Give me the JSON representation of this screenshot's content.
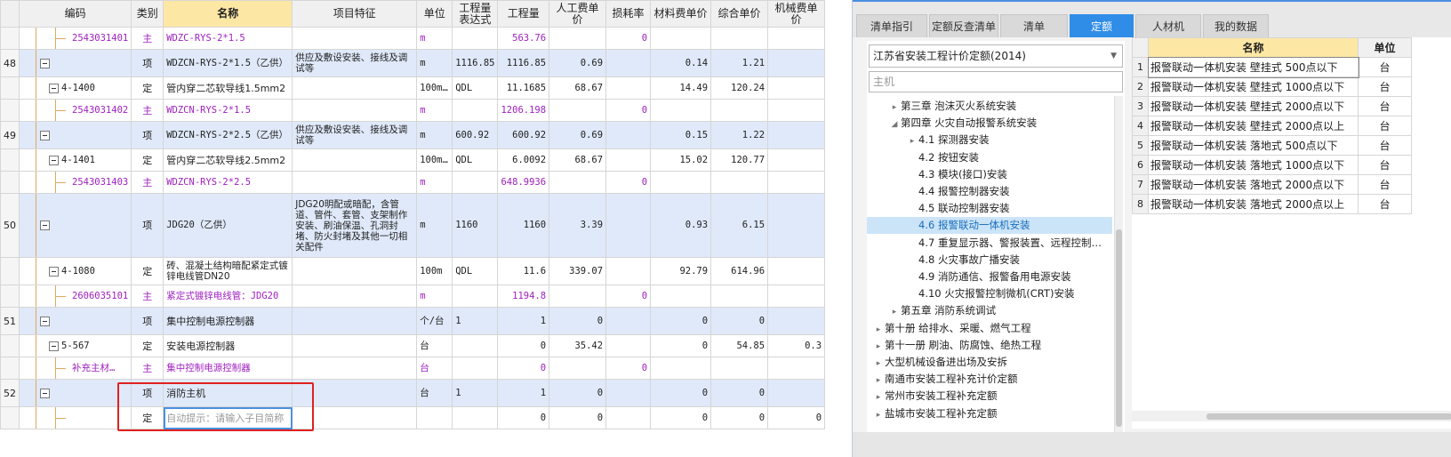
{
  "headers": [
    "",
    "编码",
    "类别",
    "名称",
    "项目特征",
    "单位",
    "工程量\n表达式",
    "工程量",
    "人工费单价",
    "损耗率",
    "材料费单价",
    "综合单价",
    "机械费单价"
  ],
  "rows": [
    {
      "type": "material",
      "num": "",
      "code": "2543031401",
      "cat": "主",
      "name": "WDZC-RYS-2*1.5",
      "feature": "",
      "unit": "m",
      "expr": "",
      "qty": "563.76",
      "labor": "",
      "loss": "0",
      "mat": "",
      "total": "",
      "mach": ""
    },
    {
      "type": "item",
      "num": "48",
      "code": "",
      "cat": "项",
      "name": "WDZCN-RYS-2*1.5（乙供）",
      "feature": "供应及敷设安装、接线及调试等",
      "unit": "m",
      "expr": "1116.85",
      "qty": "1116.85",
      "labor": "0.69",
      "loss": "",
      "mat": "0.14",
      "total": "1.21",
      "mach": ""
    },
    {
      "type": "quota",
      "num": "",
      "code": "4-1400",
      "cat": "定",
      "name": "管内穿二芯软导线1.5mm2",
      "feature": "",
      "unit": "100m…",
      "expr": "QDL",
      "qty": "11.1685",
      "labor": "68.67",
      "loss": "",
      "mat": "14.49",
      "total": "120.24",
      "mach": ""
    },
    {
      "type": "material",
      "num": "",
      "code": "2543031402",
      "cat": "主",
      "name": "WDZCN-RYS-2*1.5",
      "feature": "",
      "unit": "m",
      "expr": "",
      "qty": "1206.198",
      "labor": "",
      "loss": "0",
      "mat": "",
      "total": "",
      "mach": ""
    },
    {
      "type": "item",
      "num": "49",
      "code": "",
      "cat": "项",
      "name": "WDZCN-RYS-2*2.5（乙供）",
      "feature": "供应及敷设安装、接线及调试等",
      "unit": "m",
      "expr": "600.92",
      "qty": "600.92",
      "labor": "0.69",
      "loss": "",
      "mat": "0.15",
      "total": "1.22",
      "mach": ""
    },
    {
      "type": "quota",
      "num": "",
      "code": "4-1401",
      "cat": "定",
      "name": "管内穿二芯软导线2.5mm2",
      "feature": "",
      "unit": "100m…",
      "expr": "QDL",
      "qty": "6.0092",
      "labor": "68.67",
      "loss": "",
      "mat": "15.02",
      "total": "120.77",
      "mach": ""
    },
    {
      "type": "material",
      "num": "",
      "code": "2543031403",
      "cat": "主",
      "name": "WDZCN-RYS-2*2.5",
      "feature": "",
      "unit": "m",
      "expr": "",
      "qty": "648.9936",
      "labor": "",
      "loss": "0",
      "mat": "",
      "total": "",
      "mach": ""
    },
    {
      "type": "item",
      "num": "50",
      "code": "",
      "cat": "项",
      "name": "JDG20（乙供）",
      "feature": "JDG20明配或暗配，含管道、管件、套管、支架制作安装、刷油保温、孔洞封堵、防火封堵及其他一切相关配件",
      "unit": "m",
      "expr": "1160",
      "qty": "1160",
      "labor": "3.39",
      "loss": "",
      "mat": "0.93",
      "total": "6.15",
      "mach": ""
    },
    {
      "type": "quota",
      "num": "",
      "code": "4-1080",
      "cat": "定",
      "name": "砖、混凝土结构暗配紧定式镀锌电线管DN20",
      "feature": "",
      "unit": "100m",
      "expr": "QDL",
      "qty": "11.6",
      "labor": "339.07",
      "loss": "",
      "mat": "92.79",
      "total": "614.96",
      "mach": ""
    },
    {
      "type": "material",
      "num": "",
      "code": "2606035101",
      "cat": "主",
      "name": "紧定式镀锌电线管：JDG20",
      "feature": "",
      "unit": "m",
      "expr": "",
      "qty": "1194.8",
      "labor": "",
      "loss": "0",
      "mat": "",
      "total": "",
      "mach": ""
    },
    {
      "type": "item",
      "num": "51",
      "code": "",
      "cat": "项",
      "name": "集中控制电源控制器",
      "feature": "",
      "unit": "个/台",
      "expr": "1",
      "qty": "1",
      "labor": "0",
      "loss": "",
      "mat": "0",
      "total": "0",
      "mach": ""
    },
    {
      "type": "quota",
      "num": "",
      "code": "5-567",
      "cat": "定",
      "name": "安装电源控制器",
      "feature": "",
      "unit": "台",
      "expr": "",
      "qty": "0",
      "labor": "35.42",
      "loss": "",
      "mat": "0",
      "total": "54.85",
      "mach": "0.3"
    },
    {
      "type": "material",
      "num": "",
      "code": "补充主材…",
      "cat": "主",
      "name": "集中控制电源控制器",
      "feature": "",
      "unit": "台",
      "expr": "",
      "qty": "0",
      "labor": "",
      "loss": "0",
      "mat": "",
      "total": "",
      "mach": ""
    },
    {
      "type": "item",
      "num": "52",
      "code": "",
      "cat": "项",
      "name": "消防主机",
      "feature": "",
      "unit": "台",
      "expr": "1",
      "qty": "1",
      "labor": "0",
      "loss": "",
      "mat": "0",
      "total": "0",
      "mach": ""
    },
    {
      "type": "edit",
      "num": "",
      "code": "",
      "cat": "定",
      "name": "自动提示：请输入子目简称",
      "feature": "",
      "unit": "",
      "expr": "",
      "qty": "0",
      "labor": "0",
      "loss": "",
      "mat": "0",
      "total": "0",
      "mach": "0"
    }
  ],
  "right": {
    "tabs": [
      "清单指引",
      "定额反查清单",
      "清单",
      "定额",
      "人材机",
      "我的数据"
    ],
    "active_tab": 3,
    "combo": "江苏省安装工程计价定额(2014)",
    "search_placeholder": "主机",
    "tree": [
      {
        "label": "第三章 泡沫灭火系统安装",
        "level": 1,
        "tw": "▸"
      },
      {
        "label": "第四章 火灾自动报警系统安装",
        "level": 1,
        "tw": "◢"
      },
      {
        "label": "4.1 探测器安装",
        "level": 2,
        "tw": "▸"
      },
      {
        "label": "4.2 按钮安装",
        "level": 2,
        "tw": ""
      },
      {
        "label": "4.3 模块(接口)安装",
        "level": 2,
        "tw": ""
      },
      {
        "label": "4.4 报警控制器安装",
        "level": 2,
        "tw": ""
      },
      {
        "label": "4.5 联动控制器安装",
        "level": 2,
        "tw": ""
      },
      {
        "label": "4.6 报警联动一体机安装",
        "level": 2,
        "tw": "",
        "sel": true
      },
      {
        "label": "4.7 重复显示器、警报装置、远程控制…",
        "level": 2,
        "tw": ""
      },
      {
        "label": "4.8 火灾事故广播安装",
        "level": 2,
        "tw": ""
      },
      {
        "label": "4.9 消防通信、报警备用电源安装",
        "level": 2,
        "tw": ""
      },
      {
        "label": "4.10 火灾报警控制微机(CRT)安装",
        "level": 2,
        "tw": ""
      },
      {
        "label": "第五章 消防系统调试",
        "level": 1,
        "tw": "▸"
      },
      {
        "label": "第十册 给排水、采暖、燃气工程",
        "level": 0,
        "tw": "▸"
      },
      {
        "label": "第十一册 刷油、防腐蚀、绝热工程",
        "level": 0,
        "tw": "▸"
      },
      {
        "label": "大型机械设备进出场及安拆",
        "level": 0,
        "tw": "▸"
      },
      {
        "label": "南通市安装工程补充计价定额",
        "level": 0,
        "tw": "▸"
      },
      {
        "label": "常州市安装工程补充定额",
        "level": 0,
        "tw": "▸"
      },
      {
        "label": "盐城市安装工程补充定额",
        "level": 0,
        "tw": "▸"
      }
    ],
    "table_headers": [
      "",
      "名称",
      "单位"
    ],
    "items": [
      {
        "idx": "1",
        "name": "报警联动一体机安装 壁挂式 500点以下",
        "unit": "台"
      },
      {
        "idx": "2",
        "name": "报警联动一体机安装 壁挂式 1000点以下",
        "unit": "台"
      },
      {
        "idx": "3",
        "name": "报警联动一体机安装 壁挂式 2000点以下",
        "unit": "台"
      },
      {
        "idx": "4",
        "name": "报警联动一体机安装 壁挂式 2000点以上",
        "unit": "台"
      },
      {
        "idx": "5",
        "name": "报警联动一体机安装 落地式 500点以下",
        "unit": "台"
      },
      {
        "idx": "6",
        "name": "报警联动一体机安装 落地式 1000点以下",
        "unit": "台"
      },
      {
        "idx": "7",
        "name": "报警联动一体机安装 落地式 2000点以下",
        "unit": "台"
      },
      {
        "idx": "8",
        "name": "报警联动一体机安装 落地式 2000点以上",
        "unit": "台"
      }
    ]
  },
  "colors": {
    "accent": "#2f8de8",
    "item_row": "#dfe9f9",
    "material_text": "#a020c0",
    "header_highlight": "#fde7a4",
    "callout": "#e02020"
  }
}
